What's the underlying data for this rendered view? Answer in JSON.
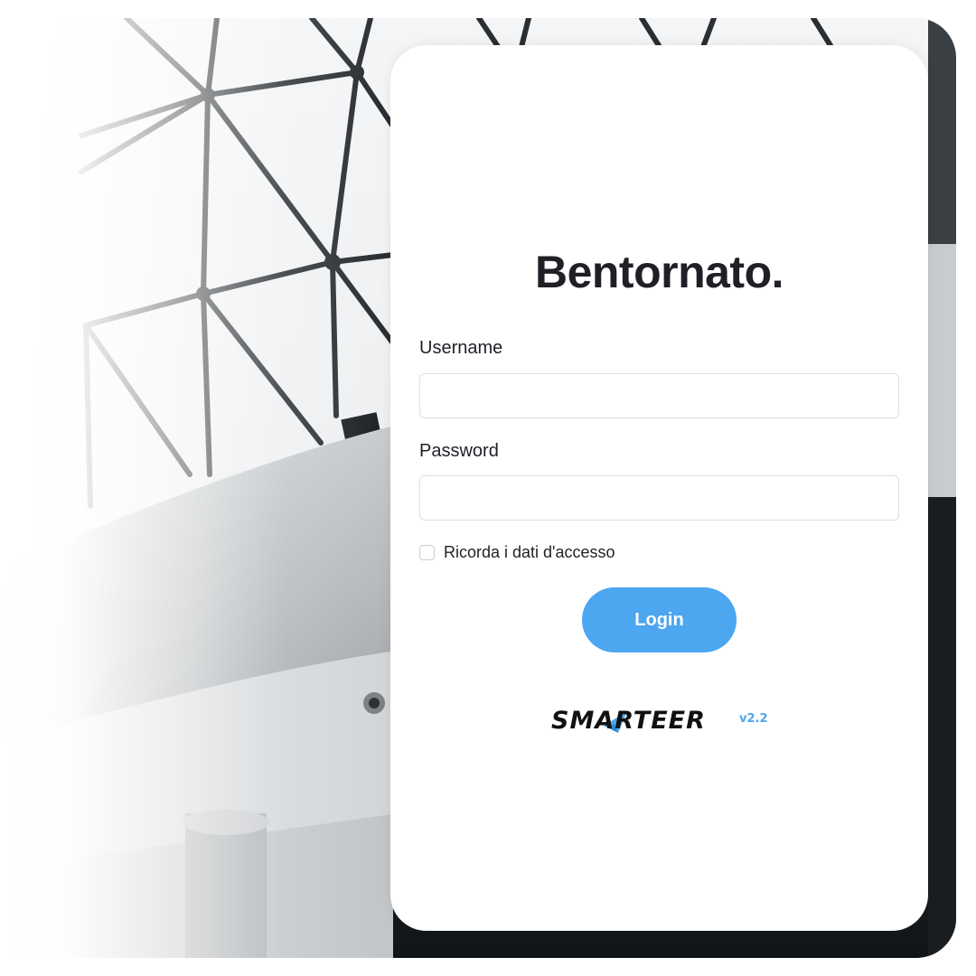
{
  "login": {
    "title": "Bentornato.",
    "username_label": "Username",
    "username_value": "",
    "password_label": "Password",
    "password_value": "",
    "remember_label": "Ricorda i dati d'accesso",
    "remember_checked": false,
    "login_button": "Login"
  },
  "brand": {
    "logo_text": "SMARTEER",
    "version": "v2.2",
    "accent_color": "#4da6f0"
  },
  "icons": {
    "logo_mark": "paper-plane-icon"
  }
}
